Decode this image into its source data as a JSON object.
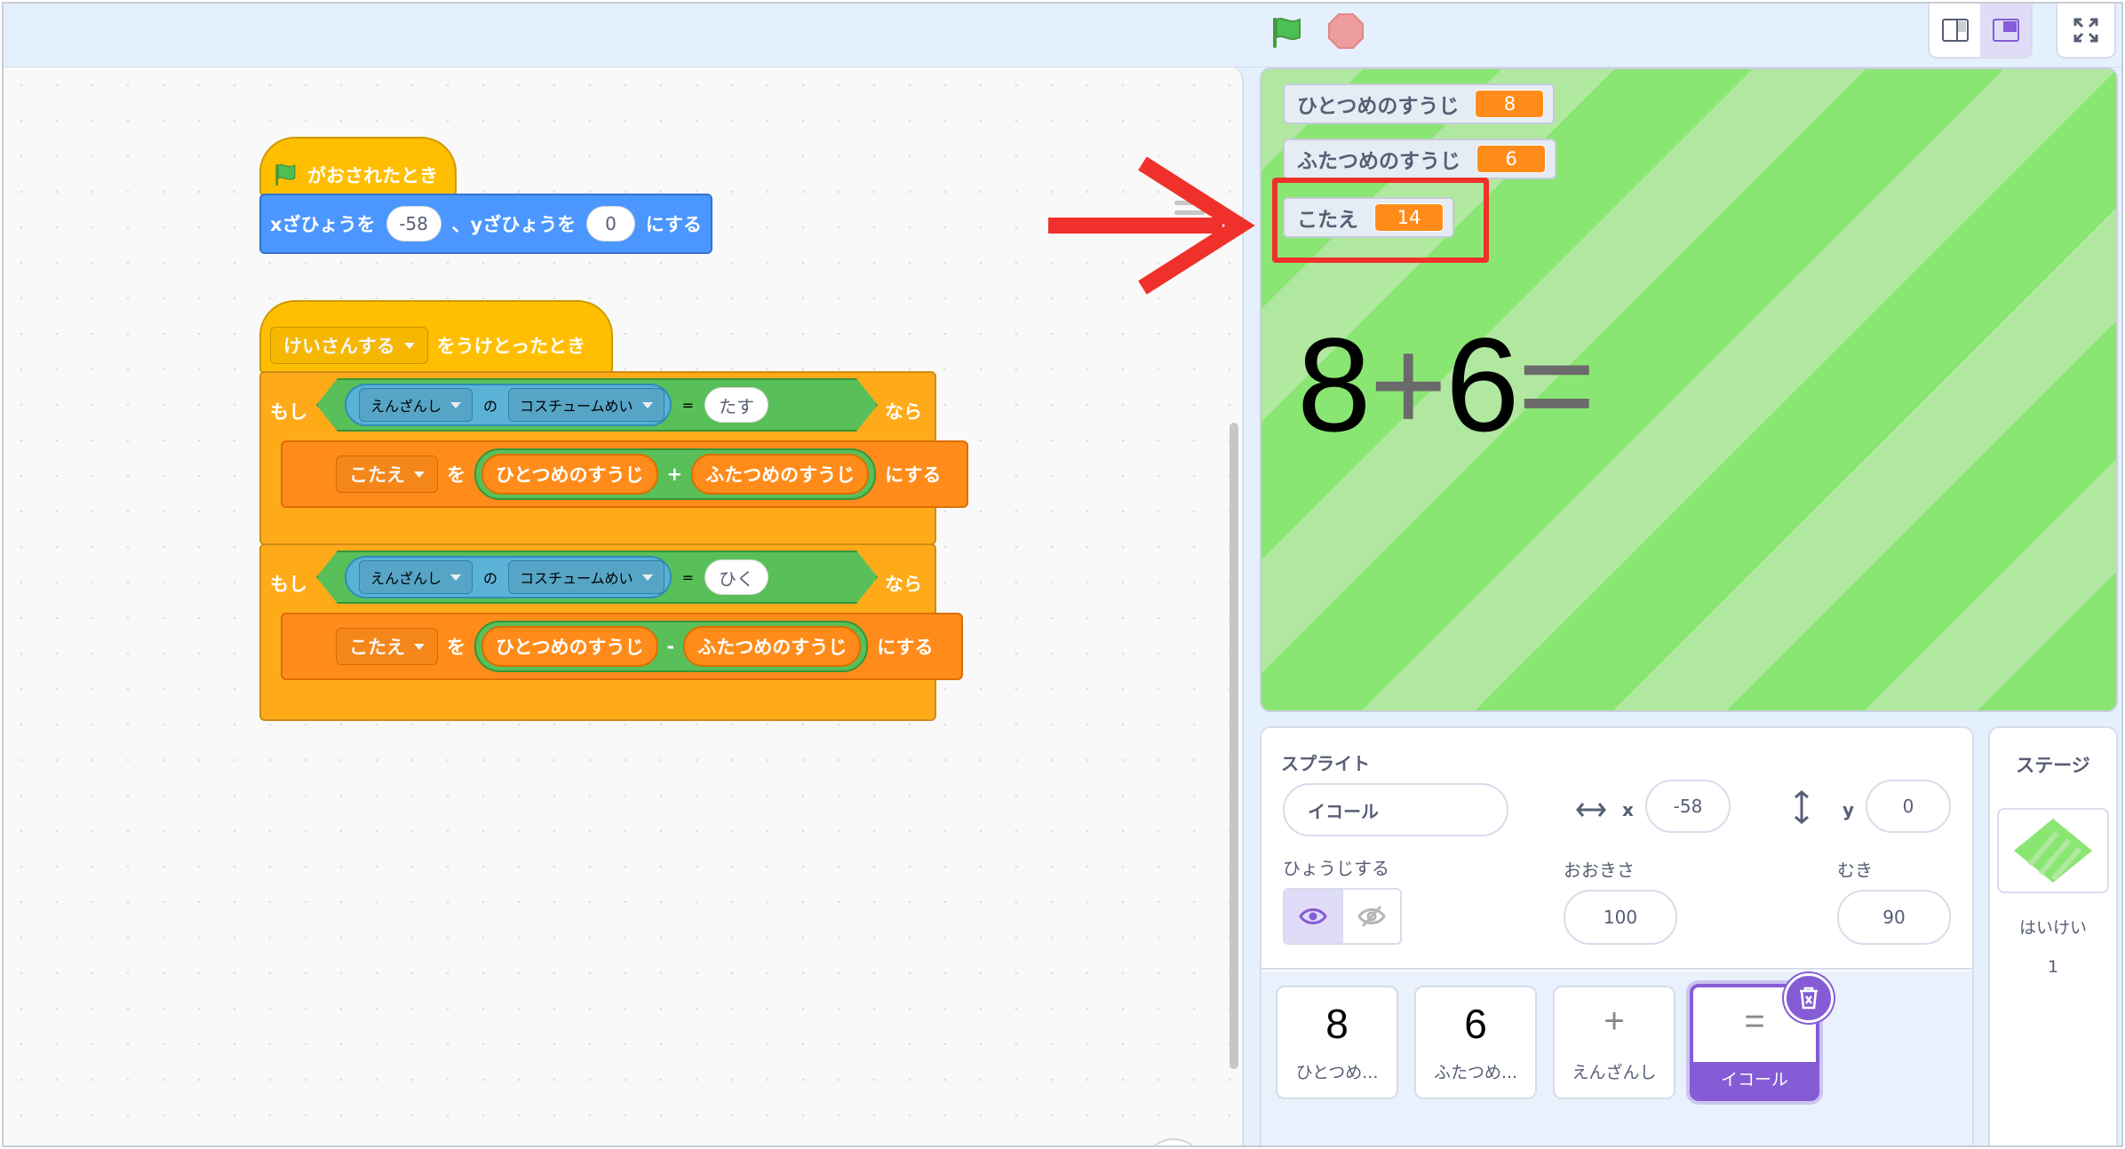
{
  "code": {
    "script1": {
      "hat_label": "がおされたとき",
      "goto_x_label": "xざひょうを",
      "goto_x_value": "-58",
      "goto_sep": "、yざひょうを",
      "goto_y_value": "0",
      "goto_suffix": "にする"
    },
    "script2": {
      "hat_message": "けいさんする",
      "hat_suffix": "をうけとったとき",
      "if1": {
        "if_label": "もし",
        "sprite": "えんざんし",
        "of_label": "の",
        "property": "コスチュームめい",
        "equals": "=",
        "compare_value": "たす",
        "then_label": "なら",
        "set_var": "こたえ",
        "set_to_label": "を",
        "operand1": "ひとつめのすうじ",
        "operator": "+",
        "operand2": "ふたつめのすうじ",
        "set_suffix": "にする"
      },
      "if2": {
        "if_label": "もし",
        "sprite": "えんざんし",
        "of_label": "の",
        "property": "コスチュームめい",
        "equals": "=",
        "compare_value": "ひく",
        "then_label": "なら",
        "set_var": "こたえ",
        "set_to_label": "を",
        "operand1": "ひとつめのすうじ",
        "operator": "-",
        "operand2": "ふたつめのすうじ",
        "set_suffix": "にする"
      }
    }
  },
  "stage": {
    "monitors": [
      {
        "label": "ひとつめのすうじ",
        "value": "8"
      },
      {
        "label": "ふたつめのすうじ",
        "value": "6"
      },
      {
        "label": "こたえ",
        "value": "14"
      }
    ],
    "equation": {
      "n1": "8",
      "op": "+",
      "n2": "6",
      "eq": "="
    },
    "colors": {
      "stripe_dark": "#8ae672",
      "stripe_light": "#b1e8a0",
      "highlight": "#f0302a"
    }
  },
  "sprite_info": {
    "section_label": "スプライト",
    "name": "イコール",
    "x_label": "x",
    "x_value": "-58",
    "y_label": "y",
    "y_value": "0",
    "show_label": "ひょうじする",
    "size_label": "おおきさ",
    "size_value": "100",
    "direction_label": "むき",
    "direction_value": "90"
  },
  "sprites": [
    {
      "glyph": "8",
      "name": "ひとつめ..."
    },
    {
      "glyph": "6",
      "name": "ふたつめ..."
    },
    {
      "glyph": "+",
      "name": "えんざんし"
    },
    {
      "glyph": "=",
      "name": "イコール",
      "selected": true
    }
  ],
  "stage_pane": {
    "title": "ステージ",
    "backdrop_label": "はいけい",
    "backdrop_count": "1"
  }
}
